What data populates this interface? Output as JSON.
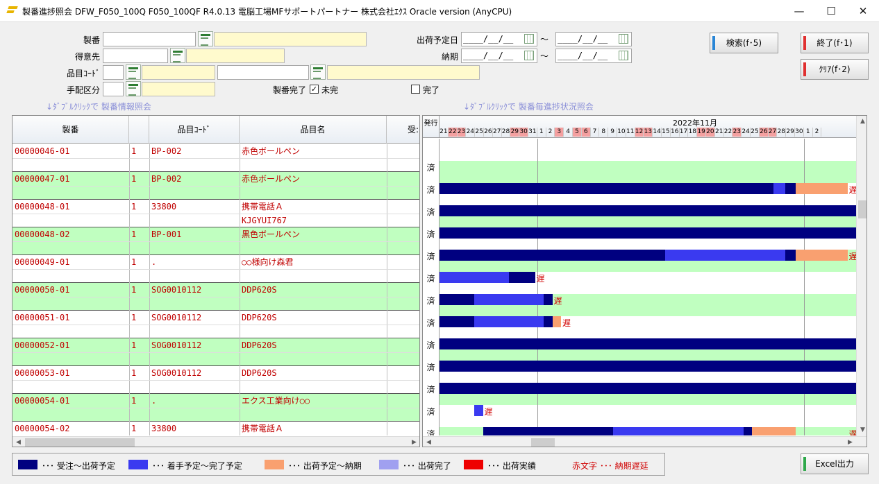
{
  "window": {
    "title": "製番進捗照会  DFW_F050_100Q  F050_100QF  R4.0.13  電脳工場MFサポートパートナー  株式会社ｴｸｽ  Oracle version  (AnyCPU)",
    "minimize": "—",
    "maximize": "☐",
    "close": "✕"
  },
  "form": {
    "seiban_label": "製番",
    "tokuisaki_label": "得意先",
    "hinmoku_label": "品目ｺｰﾄﾞ",
    "tehai_label": "手配区分",
    "shukka_label": "出荷予定日",
    "nouki_label": "納期",
    "date_placeholder": "____/__/__",
    "tilde": "～",
    "kanryo_label": "製番完了",
    "mikan_label": "未完",
    "mikan_checked": "✓",
    "kanryo_label2": "完了",
    "hint_left": "↓ﾀﾞﾌﾞﾙｸﾘｯｸで 製番情報照会",
    "hint_right": "↓ﾀﾞﾌﾞﾙｸﾘｯｸで 製番毎進捗状況照会"
  },
  "buttons": {
    "search": "検索(f･5)",
    "exit": "終了(f･1)",
    "clear": "ｸﾘｱ(f･2)",
    "excel": "Excel出力"
  },
  "grid": {
    "headers": [
      "製番",
      "",
      "品目ｺｰﾄﾞ",
      "品目名",
      "受:"
    ],
    "rows": [
      {
        "seiban": "00000046-01",
        "no": "1",
        "code": "BP-002",
        "name": "赤色ボールペン",
        "name2": "",
        "green": false
      },
      {
        "seiban": "00000047-01",
        "no": "1",
        "code": "BP-002",
        "name": "赤色ボールペン",
        "name2": "",
        "green": true
      },
      {
        "seiban": "00000048-01",
        "no": "1",
        "code": "33800",
        "name": "携帯電話Ａ",
        "name2": "KJGYUI767",
        "green": false
      },
      {
        "seiban": "00000048-02",
        "no": "1",
        "code": "BP-001",
        "name": "黒色ボールペン",
        "name2": "",
        "green": true
      },
      {
        "seiban": "00000049-01",
        "no": "1",
        "code": ".",
        "name": "○○様向け森君",
        "name2": "",
        "green": false
      },
      {
        "seiban": "00000050-01",
        "no": "1",
        "code": "SOG0010112",
        "name": "DDP620S",
        "name2": "",
        "green": true
      },
      {
        "seiban": "00000051-01",
        "no": "1",
        "code": "SOG0010112",
        "name": "DDP620S",
        "name2": "",
        "green": false
      },
      {
        "seiban": "00000052-01",
        "no": "1",
        "code": "SOG0010112",
        "name": "DDP620S",
        "name2": "",
        "green": true
      },
      {
        "seiban": "00000053-01",
        "no": "1",
        "code": "SOG0010112",
        "name": "DDP620S",
        "name2": "",
        "green": false
      },
      {
        "seiban": "00000054-01",
        "no": "1",
        "code": ".",
        "name": "エクス工業向け○○",
        "name2": "",
        "green": true
      },
      {
        "seiban": "00000054-02",
        "no": "1",
        "code": "33800",
        "name": "携帯電話Ａ",
        "name2": "",
        "green": false
      }
    ]
  },
  "gantt": {
    "hakko_label": "発行",
    "month_label": "2022年11月",
    "days_oct": [
      "21",
      "22",
      "23",
      "24",
      "25",
      "26",
      "27",
      "28",
      "29",
      "30",
      "31"
    ],
    "days_oct_red": [
      "22",
      "23",
      "29",
      "30"
    ],
    "days_nov": [
      "1",
      "2",
      "3",
      "4",
      "5",
      "6",
      "7",
      "8",
      "9",
      "10",
      "11",
      "12",
      "13",
      "14",
      "15",
      "16",
      "17",
      "18",
      "19",
      "20",
      "21",
      "22",
      "23",
      "24",
      "25",
      "26",
      "27",
      "28",
      "29",
      "30"
    ],
    "days_nov_red": [
      "3",
      "5",
      "6",
      "12",
      "13",
      "19",
      "20",
      "23",
      "26",
      "27"
    ],
    "days_dec": [
      "1",
      "2"
    ],
    "zumi": "済",
    "okure": "遅",
    "rows": [
      {
        "status": "",
        "green": false,
        "bars": []
      },
      {
        "status": "済",
        "green": true,
        "bars": []
      },
      {
        "status": "済",
        "green": false,
        "bars": [
          {
            "t": "o",
            "s": 0,
            "e": 38.5
          },
          {
            "t": "s",
            "s": 38.5,
            "e": 39.8
          },
          {
            "t": "o",
            "s": 39.8,
            "e": 41
          },
          {
            "t": "n",
            "s": 41,
            "e": 47
          }
        ],
        "late": true,
        "late_at": 47
      },
      {
        "status": "済",
        "green": true,
        "bars": [
          {
            "t": "o",
            "s": 0,
            "e": 48
          }
        ]
      },
      {
        "status": "済",
        "green": false,
        "bars": [
          {
            "t": "o",
            "s": 0,
            "e": 48
          }
        ]
      },
      {
        "status": "済",
        "green": true,
        "bars": [
          {
            "t": "o",
            "s": 0,
            "e": 26
          },
          {
            "t": "s",
            "s": 26,
            "e": 39.8
          },
          {
            "t": "o",
            "s": 39.8,
            "e": 41
          },
          {
            "t": "n",
            "s": 41,
            "e": 47
          }
        ],
        "late": true,
        "late_at": 47
      },
      {
        "status": "済",
        "green": false,
        "bars": [
          {
            "t": "s",
            "s": 0,
            "e": 8
          },
          {
            "t": "o",
            "s": 8,
            "e": 11
          }
        ],
        "late": true,
        "late_at": 11
      },
      {
        "status": "済",
        "green": true,
        "bars": [
          {
            "t": "o",
            "s": 0,
            "e": 4
          },
          {
            "t": "s",
            "s": 4,
            "e": 12
          },
          {
            "t": "o",
            "s": 12,
            "e": 13
          }
        ],
        "late": true,
        "late_at": 13
      },
      {
        "status": "済",
        "green": false,
        "bars": [
          {
            "t": "o",
            "s": 0,
            "e": 4
          },
          {
            "t": "s",
            "s": 4,
            "e": 12
          },
          {
            "t": "o",
            "s": 12,
            "e": 13
          },
          {
            "t": "n",
            "s": 13,
            "e": 14
          }
        ],
        "late": true,
        "late_at": 14
      },
      {
        "status": "済",
        "green": true,
        "bars": [
          {
            "t": "o",
            "s": 0,
            "e": 48
          }
        ]
      },
      {
        "status": "済",
        "green": false,
        "bars": [
          {
            "t": "o",
            "s": 0,
            "e": 48
          }
        ]
      },
      {
        "status": "済",
        "green": true,
        "bars": [
          {
            "t": "o",
            "s": 0,
            "e": 48
          }
        ]
      },
      {
        "status": "済",
        "green": false,
        "bars": [
          {
            "t": "s",
            "s": 4,
            "e": 5
          }
        ],
        "late": true,
        "late_at": 5
      },
      {
        "status": "済",
        "green": true,
        "bars": [
          {
            "t": "o",
            "s": 5,
            "e": 20
          },
          {
            "t": "s",
            "s": 20,
            "e": 35
          },
          {
            "t": "o",
            "s": 35,
            "e": 36
          },
          {
            "t": "n",
            "s": 36,
            "e": 41
          }
        ],
        "late": true,
        "late_at": 47
      }
    ]
  },
  "legend": {
    "items": [
      {
        "color": "#000080",
        "text": "･･･  受注～出荷予定"
      },
      {
        "color": "#3a3af0",
        "text": "･･･  着手予定～完了予定"
      },
      {
        "color": "#f9a070",
        "text": "･･･  出荷予定～納期"
      },
      {
        "color": "#a0a0f0",
        "text": "･･･  出荷完了"
      },
      {
        "color": "#ee0000",
        "text": "･･･  出荷実績"
      }
    ],
    "red_text": "赤文字  ･･･  納期遅延"
  }
}
